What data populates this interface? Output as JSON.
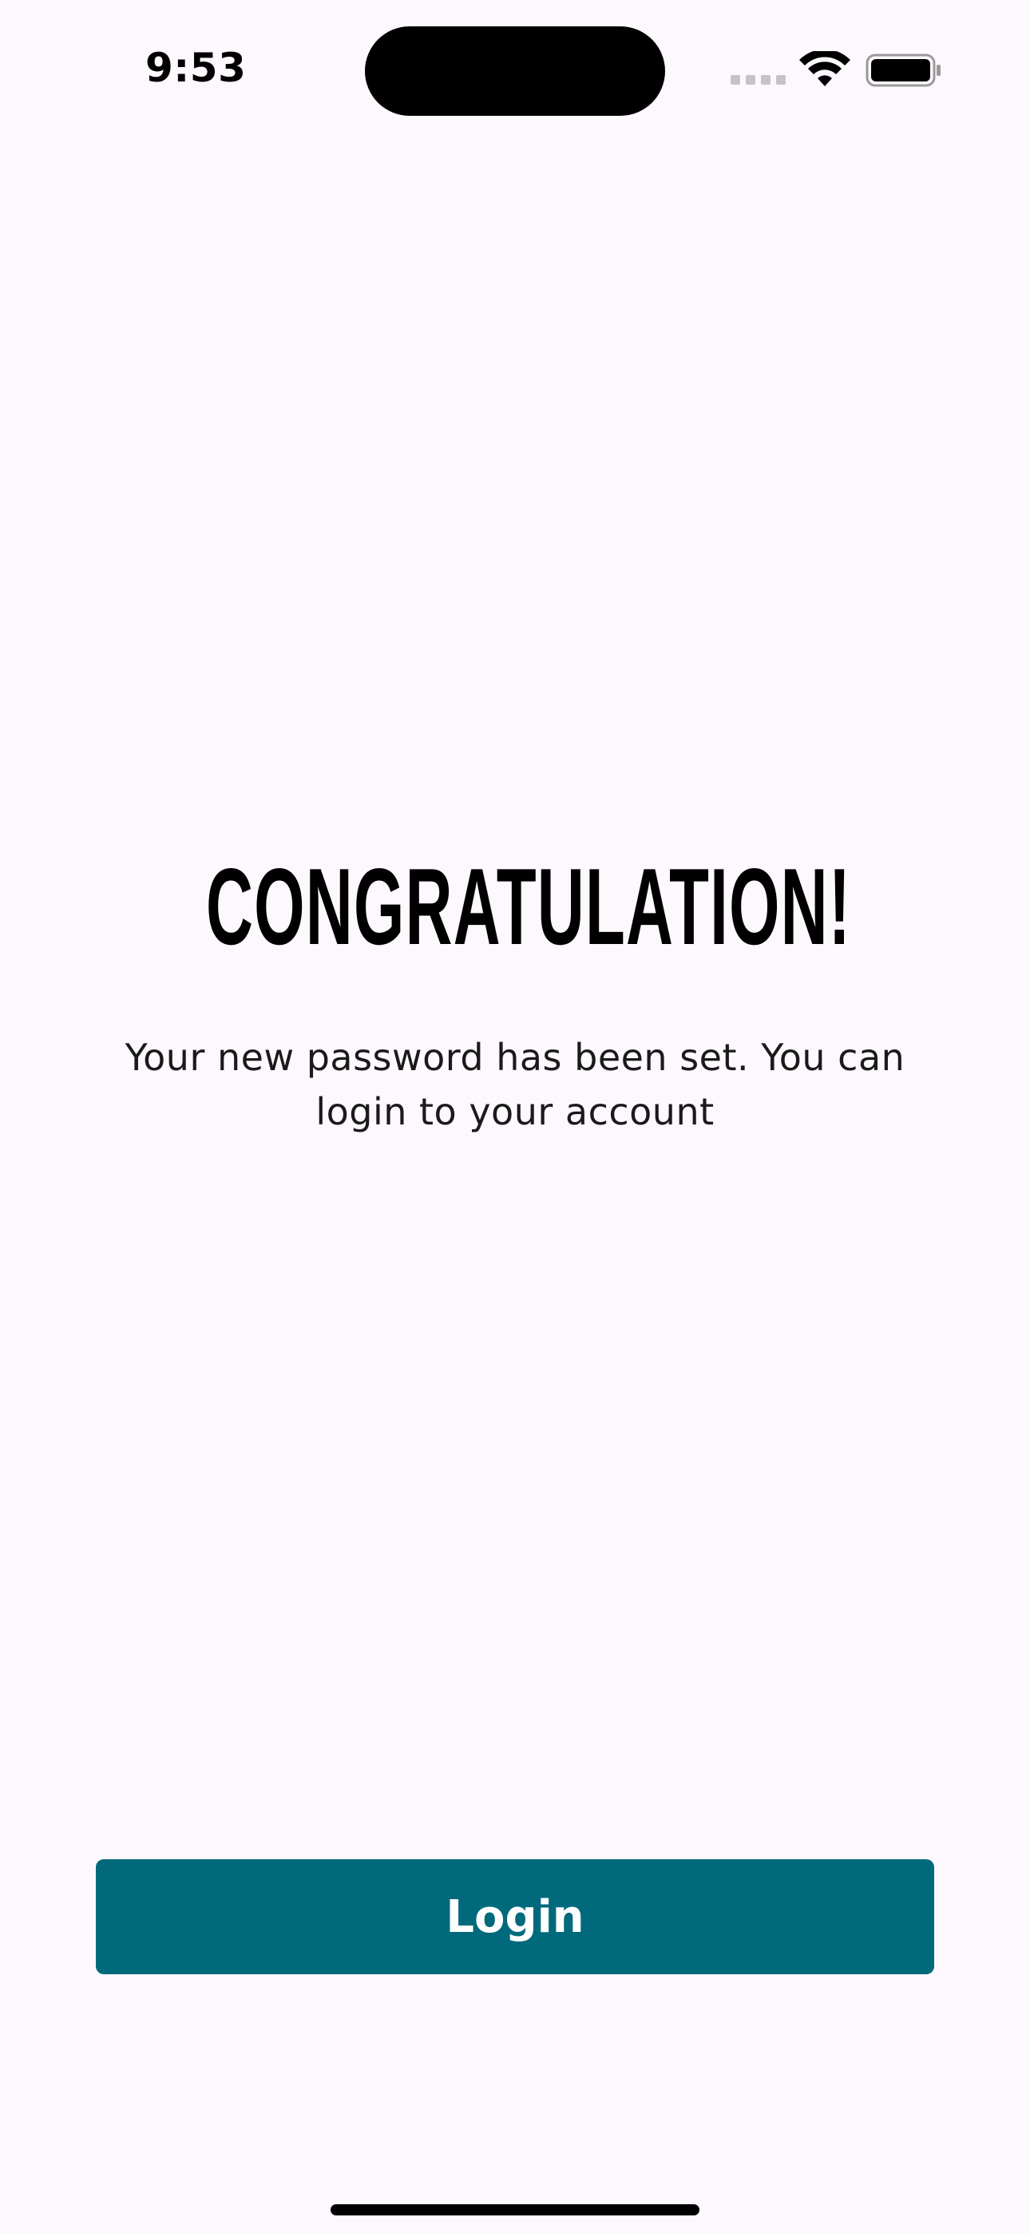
{
  "status_bar": {
    "time": "9:53",
    "icons": [
      "signal-icon",
      "wifi-icon",
      "battery-icon"
    ]
  },
  "main": {
    "title": "CONGRATULATION!",
    "message": "Your new password has been set. You can login to your account"
  },
  "actions": {
    "login_label": "Login"
  },
  "colors": {
    "background": "#fdf8fd",
    "primary": "#006a7c",
    "text": "#000000",
    "button_text": "#ffffff"
  }
}
